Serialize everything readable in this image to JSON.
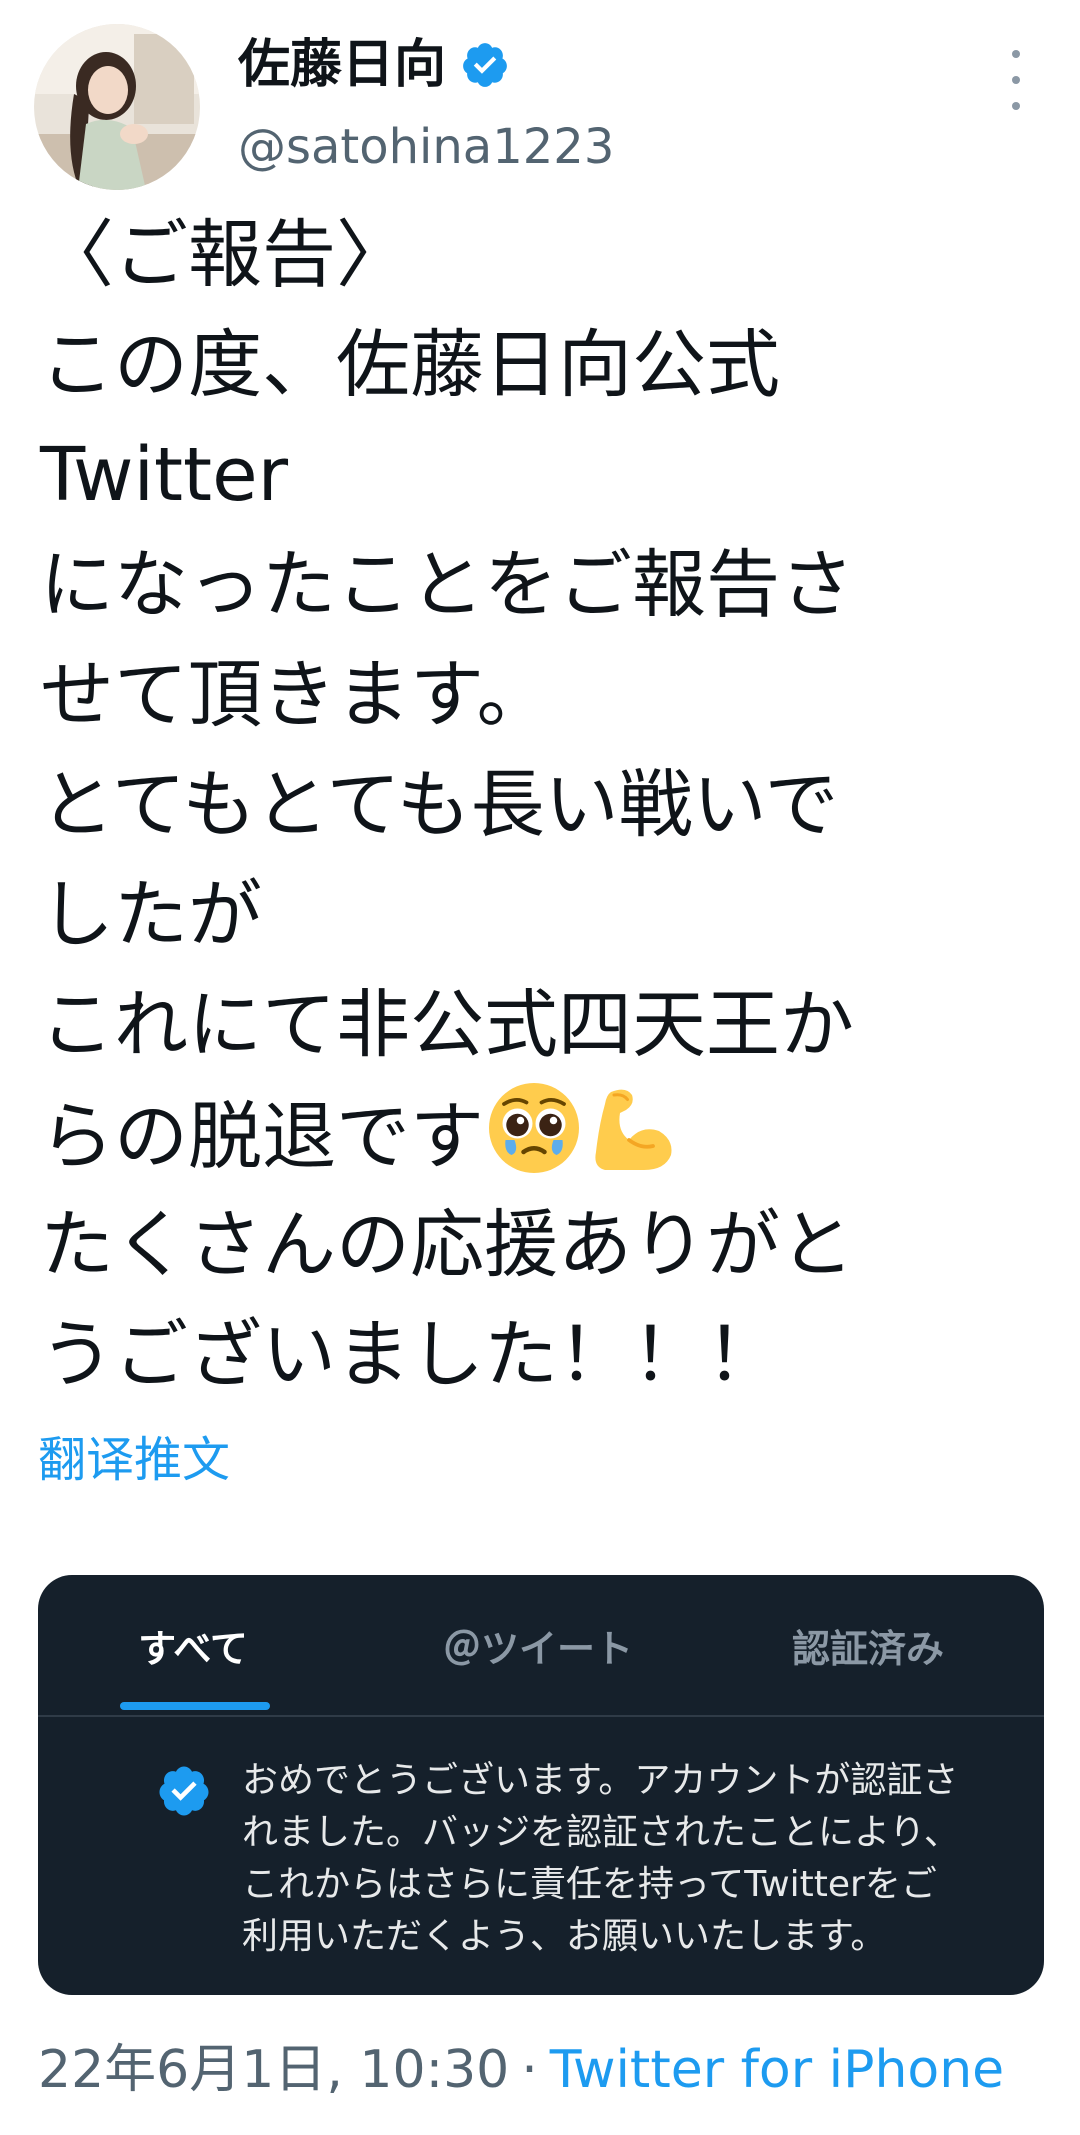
{
  "author": {
    "display_name": "佐藤日向",
    "handle": "@satohina1223",
    "verified": true
  },
  "tweet": {
    "lines": [
      "〈ご報告〉",
      "この度、佐藤日向公式",
      "Twitter",
      "になったことをご報告さ",
      "せて頂きます。",
      "とてもとても長い戦いで",
      "したが",
      "これにて非公式四天王か",
      "らの脱退です",
      "たくさんの応援ありがと",
      "うございました！！！"
    ],
    "emojis": [
      "pleading-face-emoji",
      "flexed-biceps-emoji"
    ],
    "translate_label": "翻译推文"
  },
  "card": {
    "tabs": [
      {
        "label": "すべて",
        "active": true
      },
      {
        "label": "＠ツイート",
        "active": false
      },
      {
        "label": "認証済み",
        "active": false
      }
    ],
    "notice_lines": [
      "おめでとうございます。アカウントが認証さ",
      "れました。バッジを認証されたことにより、",
      "これからはさらに責任を持ってTwitterをご",
      "利用いただくよう、お願いいたします。"
    ]
  },
  "footer": {
    "timestamp": "22年6月1日, 10:30",
    "separator": "·",
    "source": "Twitter for iPhone"
  },
  "colors": {
    "accent": "#1d9bf0",
    "text": "#0f1419",
    "secondary": "#536471",
    "card_bg": "#15202b"
  }
}
